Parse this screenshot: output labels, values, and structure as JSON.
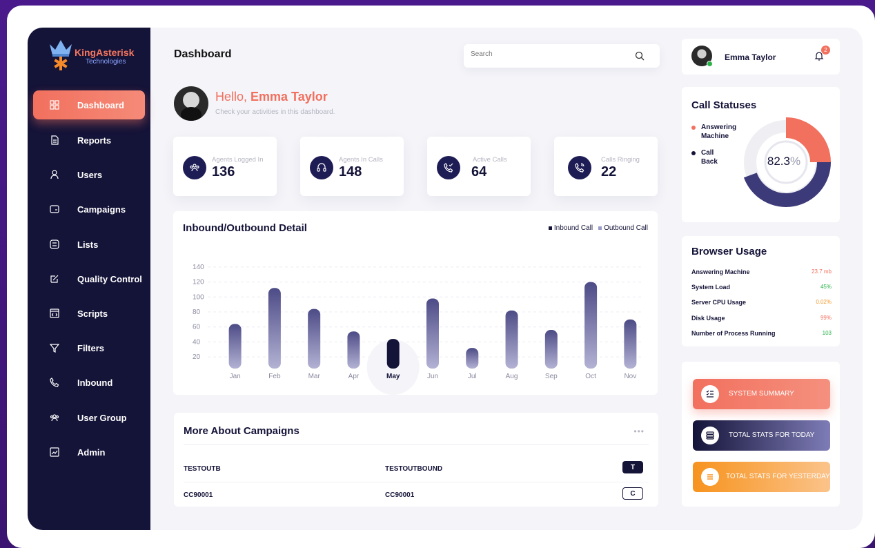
{
  "brand": {
    "name": "KingAsterisk",
    "sub": "Technologies"
  },
  "sidebar": {
    "items": [
      {
        "label": "Dashboard",
        "icon": "grid-icon",
        "active": true
      },
      {
        "label": "Reports",
        "icon": "document-icon"
      },
      {
        "label": "Users",
        "icon": "user-icon"
      },
      {
        "label": "Campaigns",
        "icon": "folder-icon"
      },
      {
        "label": "Lists",
        "icon": "list-icon"
      },
      {
        "label": "Quality Control",
        "icon": "edit-icon"
      },
      {
        "label": "Scripts",
        "icon": "code-icon"
      },
      {
        "label": "Filters",
        "icon": "filter-icon"
      },
      {
        "label": "Inbound",
        "icon": "phone-icon"
      },
      {
        "label": "User Group",
        "icon": "users-group-icon"
      },
      {
        "label": "Admin",
        "icon": "chart-icon"
      }
    ]
  },
  "header": {
    "title": "Dashboard",
    "search_placeholder": "Search"
  },
  "greeting": {
    "hello": "Hello, ",
    "name": "Emma Taylor",
    "sub": "Check your activities in this dashboard."
  },
  "stats": [
    {
      "label": "Agents Logged In",
      "value": "136",
      "icon": "agents-icon"
    },
    {
      "label": "Agents In Calls",
      "value": "148",
      "icon": "headset-icon"
    },
    {
      "label": "Active Calls",
      "value": "64",
      "icon": "phone-check-icon"
    },
    {
      "label": "Calls Ringing",
      "value": "22",
      "icon": "phone-ringing-icon"
    }
  ],
  "chart_data": {
    "type": "bar",
    "title": "Inbound/Outbound Detail",
    "categories": [
      "Jan",
      "Feb",
      "Mar",
      "Apr",
      "May",
      "Jun",
      "Jul",
      "Aug",
      "Sep",
      "Oct",
      "Nov"
    ],
    "values": [
      64,
      112,
      84,
      54,
      44,
      98,
      32,
      82,
      56,
      120,
      70
    ],
    "highlight": "May",
    "yticks": [
      20,
      40,
      60,
      80,
      100,
      120,
      140
    ],
    "ylim": [
      10,
      150
    ],
    "legend": [
      "Inbound Call",
      "Outbound Call"
    ],
    "colors": {
      "bar_top": "#4d4b86",
      "bar_bottom": "#b3b2d4",
      "highlight": "#141338",
      "legend_inbound": "#141338",
      "legend_outbound": "#9b9bc8"
    },
    "grid": true
  },
  "campaigns": {
    "title": "More About Campaigns",
    "more": "•••",
    "rows": [
      {
        "id": "TESTOUTB",
        "name": "TESTOUTBOUND",
        "badge": "T",
        "style": "dark"
      },
      {
        "id": "CC90001",
        "name": "CC90001",
        "badge": "C",
        "style": "light"
      }
    ]
  },
  "user": {
    "name": "Emma Taylor",
    "notifications": "2"
  },
  "call_statuses": {
    "title": "Call Statuses",
    "legend": [
      {
        "label": "Answering Machine",
        "color": "#f2705e"
      },
      {
        "label": "Call Back",
        "color": "#141338"
      }
    ],
    "percent_value": 82.3,
    "percent_number": "82.3",
    "percent_sign": "%"
  },
  "browser_usage": {
    "title": "Browser Usage",
    "rows": [
      {
        "label": "Answering Machine",
        "value": "23.7 mb",
        "color": "#f2705e"
      },
      {
        "label": "System Load",
        "value": "45%",
        "color": "#2bb34a"
      },
      {
        "label": "Server CPU Usage",
        "value": "0.02%",
        "color": "#f29b2e"
      },
      {
        "label": "Disk Usage",
        "value": "99%",
        "color": "#f2705e"
      },
      {
        "label": "Number of Process Running",
        "value": "103",
        "color": "#2bb34a"
      }
    ]
  },
  "summary_buttons": [
    {
      "label": "SYSTEM SUMMARY",
      "icon": "checklist-icon"
    },
    {
      "label": "TOTAL STATS FOR TODAY",
      "icon": "server-icon"
    },
    {
      "label": "TOTAL STATS FOR YESTERDAY",
      "icon": "menu-icon"
    }
  ]
}
